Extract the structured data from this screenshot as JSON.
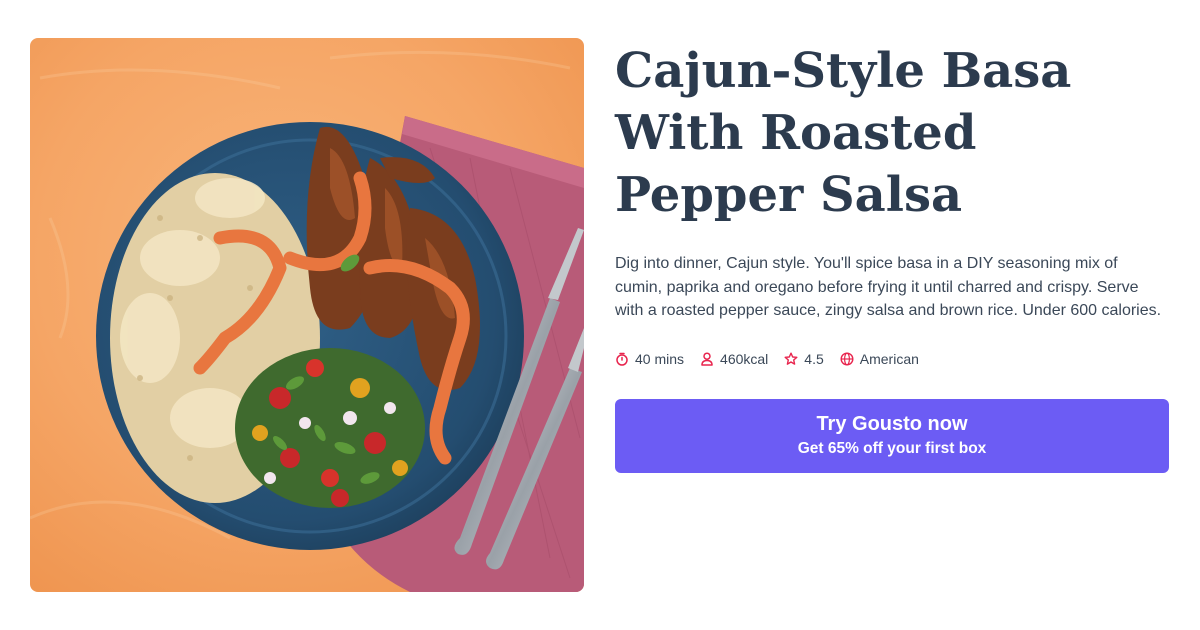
{
  "recipe": {
    "title": "Cajun-Style Basa With Roasted Pepper Salsa",
    "description": "Dig into dinner, Cajun style. You'll spice basa in a DIY seasoning mix of cumin, paprika and oregano before frying it until charred and crispy. Serve with a roasted pepper sauce, zingy salsa and brown rice. Under 600 calories.",
    "meta": {
      "time": "40 mins",
      "calories": "460kcal",
      "rating": "4.5",
      "cuisine": "American"
    }
  },
  "cta": {
    "title": "Try Gousto now",
    "subtitle": "Get 65% off your first box"
  },
  "icons": {
    "time": "stopwatch-icon",
    "calories": "person-icon",
    "rating": "star-icon",
    "cuisine": "globe-icon"
  },
  "colors": {
    "accent": "#6c5cf4",
    "icon": "#e8254e",
    "title": "#2c3b4e",
    "text": "#3b4858"
  }
}
